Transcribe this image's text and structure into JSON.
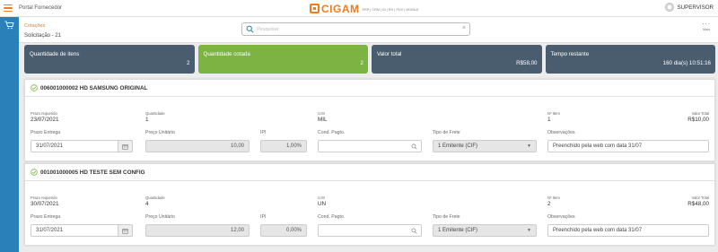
{
  "header": {
    "portal_title": "Portal Fornecedor",
    "logo_text": "CIGAM",
    "logo_subtitle": "ERP | CRM | BI | RH | PDV | MOBILE",
    "user_name": "SUPERVISOR"
  },
  "subheader": {
    "breadcrumb": "Cotações",
    "solicitation": "Solicitação - 21",
    "search_placeholder": "Pesquisar",
    "menu_label": "Mais"
  },
  "kpis": [
    {
      "label": "Quantidade de itens",
      "value": "2",
      "color": "#4a5d6e"
    },
    {
      "label": "Quantidade cotada",
      "value": "2",
      "color": "#7cb342"
    },
    {
      "label": "Valor total",
      "value": "R$58,00",
      "color": "#4a5d6e"
    },
    {
      "label": "Tempo restante",
      "value": "160 dia(s) 10:51:16",
      "color": "#4a5d6e"
    }
  ],
  "field_labels": {
    "prazo_requerido": "Prazo requerido",
    "quantidade": "Quantidade",
    "um": "U.M",
    "n_item": "Nº Item",
    "valor_total": "Valor Total",
    "prazo_entrega": "Prazo Entrega",
    "preco_unitario": "Preço Unitário",
    "ipi": "IPI",
    "cond_pagto": "Cond. Pagto.",
    "tipo_frete": "Tipo de Frete",
    "observacoes": "Observações"
  },
  "items": [
    {
      "title": "006001000002 HD SAMSUNG ORIGINAL",
      "prazo_requerido": "23/07/2021",
      "quantidade": "1",
      "um": "MIL",
      "n_item": "1",
      "valor_total": "R$10,00",
      "prazo_entrega": "31/07/2021",
      "preco_unitario": "10,00",
      "ipi": "1,00%",
      "cond_pagto": "",
      "tipo_frete": "1 Emitente (CIF)",
      "observacoes": "Preenchido pela web com data 31/07"
    },
    {
      "title": "001001000005 HD TESTE SEM CONFIG",
      "prazo_requerido": "30/07/2021",
      "quantidade": "4",
      "um": "UN",
      "n_item": "2",
      "valor_total": "R$48,00",
      "prazo_entrega": "31/07/2021",
      "preco_unitario": "12,00",
      "ipi": "0,00%",
      "cond_pagto": "",
      "tipo_frete": "1 Emitente (CIF)",
      "observacoes": "Preenchido pela web com data 31/07"
    }
  ],
  "colors": {
    "accent": "#f07c1f",
    "rail": "#2a80b9",
    "success": "#7cb342"
  }
}
